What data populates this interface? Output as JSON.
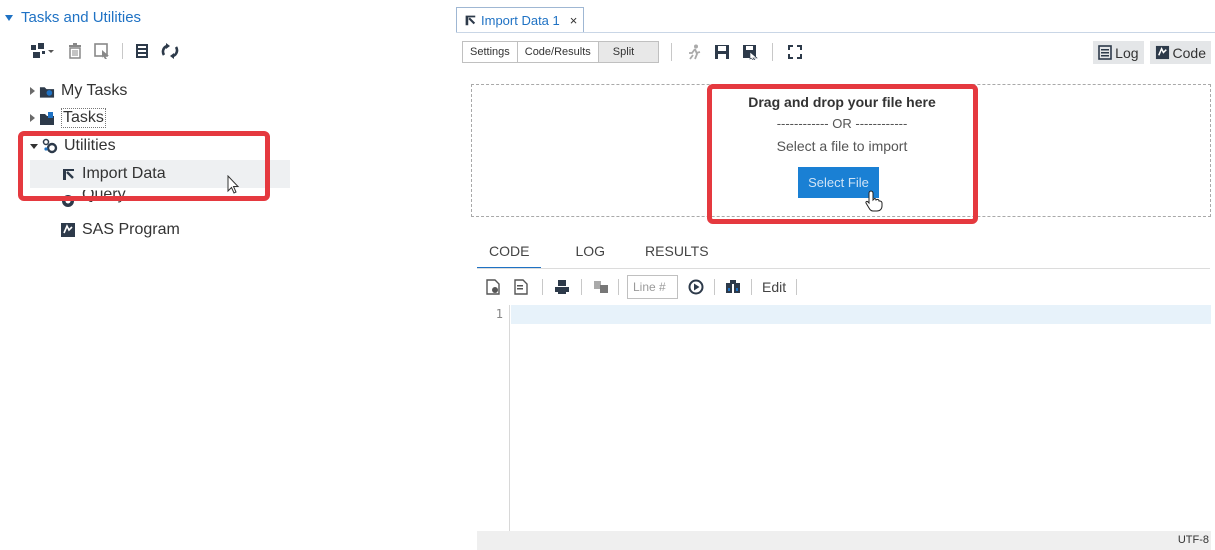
{
  "sidebar": {
    "section_title": "Tasks and Utilities",
    "tree": [
      {
        "label": "My Tasks",
        "expanded": false
      },
      {
        "label": "Tasks",
        "expanded": false
      },
      {
        "label": "Utilities",
        "expanded": true
      },
      {
        "label": "Import Data",
        "selected": true
      },
      {
        "label": "Query"
      },
      {
        "label": "SAS Program"
      }
    ]
  },
  "editor_tab": {
    "title": "Import Data 1",
    "close": "×"
  },
  "view_modes": [
    "Settings",
    "Code/Results",
    "Split"
  ],
  "right_buttons": {
    "log": "Log",
    "code": "Code"
  },
  "dropzone": {
    "title": "Drag and drop your file here",
    "or": "------------ OR ------------",
    "prompt": "Select a file to import",
    "button": "Select File"
  },
  "sub_tabs": [
    {
      "label": "CODE",
      "active": true
    },
    {
      "label": "LOG",
      "active": false
    },
    {
      "label": "RESULTS",
      "active": false
    }
  ],
  "code_toolbar": {
    "line_placeholder": "Line #",
    "edit": "Edit"
  },
  "editor": {
    "line_numbers": [
      "1"
    ],
    "encoding": "UTF-8"
  },
  "colors": {
    "accent": "#1f72c4",
    "highlight_red": "#e5393f",
    "button_blue": "#1a80d4"
  }
}
